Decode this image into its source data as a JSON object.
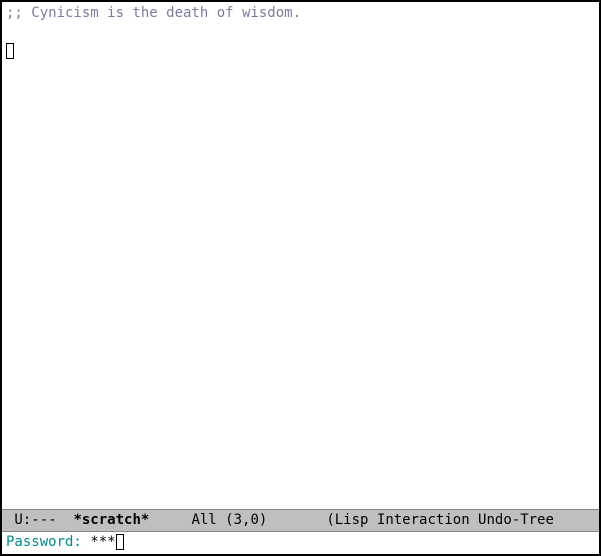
{
  "buffer": {
    "comment": ";; Cynicism is the death of wisdom."
  },
  "modeline": {
    "status": " U:---  ",
    "buffer_name": "*scratch*",
    "gap1": "     ",
    "position": "All (3,0)",
    "gap2": "       ",
    "modes": "(Lisp Interaction Undo-Tree"
  },
  "minibuffer": {
    "prompt": "Password: ",
    "masked": "***"
  }
}
